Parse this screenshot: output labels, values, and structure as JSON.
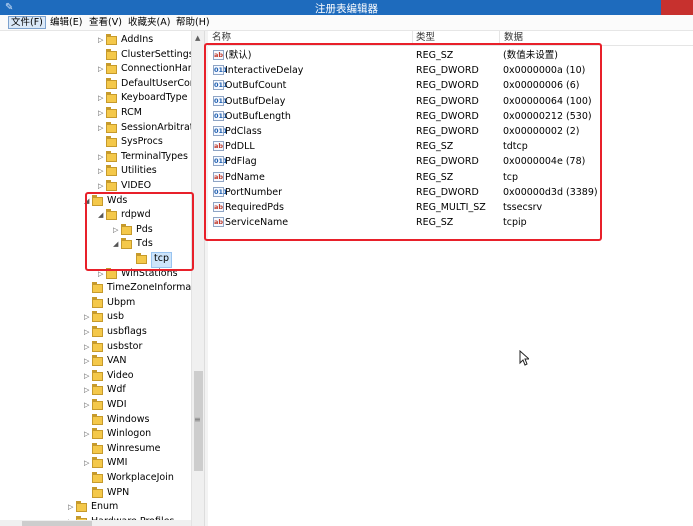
{
  "window": {
    "title": "注册表编辑器",
    "icon": "registry-editor-icon"
  },
  "menu": [
    "文件(F)",
    "编辑(E)",
    "查看(V)",
    "收藏夹(A)",
    "帮助(H)"
  ],
  "tree": [
    {
      "label": "AddIns",
      "expander": "▷"
    },
    {
      "label": "ClusterSettings",
      "expander": ""
    },
    {
      "label": "ConnectionHand",
      "expander": "▷"
    },
    {
      "label": "DefaultUserCont",
      "expander": ""
    },
    {
      "label": "KeyboardType M",
      "expander": "▷"
    },
    {
      "label": "RCM",
      "expander": "▷"
    },
    {
      "label": "SessionArbitratio",
      "expander": "▷"
    },
    {
      "label": "SysProcs",
      "expander": ""
    },
    {
      "label": "TerminalTypes",
      "expander": "▷"
    },
    {
      "label": "Utilities",
      "expander": "▷"
    },
    {
      "label": "VIDEO",
      "expander": "▷"
    },
    {
      "label": "Wds",
      "expander": "◢"
    },
    {
      "label": "rdpwd",
      "expander": "◢"
    },
    {
      "label": "Pds",
      "expander": "▷"
    },
    {
      "label": "Tds",
      "expander": "◢"
    },
    {
      "label": "tcp",
      "expander": "",
      "selected": true
    },
    {
      "label": "WinStations",
      "expander": "▷"
    },
    {
      "label": "TimeZoneInformati",
      "expander": ""
    },
    {
      "label": "Ubpm",
      "expander": ""
    },
    {
      "label": "usb",
      "expander": "▷"
    },
    {
      "label": "usbflags",
      "expander": "▷"
    },
    {
      "label": "usbstor",
      "expander": "▷"
    },
    {
      "label": "VAN",
      "expander": "▷"
    },
    {
      "label": "Video",
      "expander": "▷"
    },
    {
      "label": "Wdf",
      "expander": "▷"
    },
    {
      "label": "WDI",
      "expander": "▷"
    },
    {
      "label": "Windows",
      "expander": ""
    },
    {
      "label": "Winlogon",
      "expander": "▷"
    },
    {
      "label": "Winresume",
      "expander": ""
    },
    {
      "label": "WMI",
      "expander": "▷"
    },
    {
      "label": "WorkplaceJoin",
      "expander": ""
    },
    {
      "label": "WPN",
      "expander": ""
    },
    {
      "label": "Enum",
      "expander": "▷"
    },
    {
      "label": "Hardware Profiles",
      "expander": "▷"
    }
  ],
  "columns": [
    "名称",
    "类型",
    "数据"
  ],
  "values": [
    {
      "name": "(默认)",
      "type": "REG_SZ",
      "data": "(数值未设置)",
      "icon": "ab"
    },
    {
      "name": "InteractiveDelay",
      "type": "REG_DWORD",
      "data": "0x0000000a (10)",
      "icon": "011"
    },
    {
      "name": "OutBufCount",
      "type": "REG_DWORD",
      "data": "0x00000006 (6)",
      "icon": "011"
    },
    {
      "name": "OutBufDelay",
      "type": "REG_DWORD",
      "data": "0x00000064 (100)",
      "icon": "011"
    },
    {
      "name": "OutBufLength",
      "type": "REG_DWORD",
      "data": "0x00000212 (530)",
      "icon": "011"
    },
    {
      "name": "PdClass",
      "type": "REG_DWORD",
      "data": "0x00000002 (2)",
      "icon": "011"
    },
    {
      "name": "PdDLL",
      "type": "REG_SZ",
      "data": "tdtcp",
      "icon": "ab"
    },
    {
      "name": "PdFlag",
      "type": "REG_DWORD",
      "data": "0x0000004e (78)",
      "icon": "011"
    },
    {
      "name": "PdName",
      "type": "REG_SZ",
      "data": "tcp",
      "icon": "ab"
    },
    {
      "name": "PortNumber",
      "type": "REG_DWORD",
      "data": "0x00000d3d (3389)",
      "icon": "011"
    },
    {
      "name": "RequiredPds",
      "type": "REG_MULTI_SZ",
      "data": "tssecsrv",
      "icon": "ab"
    },
    {
      "name": "ServiceName",
      "type": "REG_SZ",
      "data": "tcpip",
      "icon": "ab"
    }
  ],
  "colors": {
    "titlebar": "#1e6bbd",
    "close": "#c7312e",
    "highlight": "#e8202a",
    "selection": "#cde4fa"
  }
}
